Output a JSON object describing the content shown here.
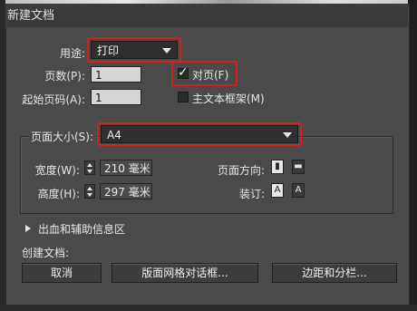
{
  "window": {
    "title": "新建文档"
  },
  "purpose": {
    "label": "用途:",
    "value": "打印"
  },
  "pages": {
    "label": "页数(P):",
    "value": "1"
  },
  "facing_pages": {
    "label": "对页(F)",
    "checked": true
  },
  "start_page": {
    "label": "起始页码(A):",
    "value": "1"
  },
  "primary_text_frame": {
    "label": "主文本框架(M)",
    "checked": false
  },
  "page_size": {
    "label": "页面大小(S):",
    "value": "A4",
    "width": {
      "label": "宽度(W):",
      "value": "210 毫米"
    },
    "height": {
      "label": "高度(H):",
      "value": "297 毫米"
    },
    "orientation_label": "页面方向:",
    "binding_label": "装订:",
    "icons": {
      "portrait": "portrait-icon",
      "landscape": "landscape-icon",
      "binding_left": "binding-left-icon",
      "binding_right": "binding-right-icon"
    }
  },
  "bleed_section": {
    "label": "出血和辅助信息区"
  },
  "create_document": {
    "label": "创建文档:",
    "cancel": "取消",
    "layout_grid": "版面网格对话框...",
    "margins_columns": "边距和分栏..."
  },
  "colors": {
    "highlight": "#d32020",
    "dialog_bg": "#4a4a4a"
  }
}
